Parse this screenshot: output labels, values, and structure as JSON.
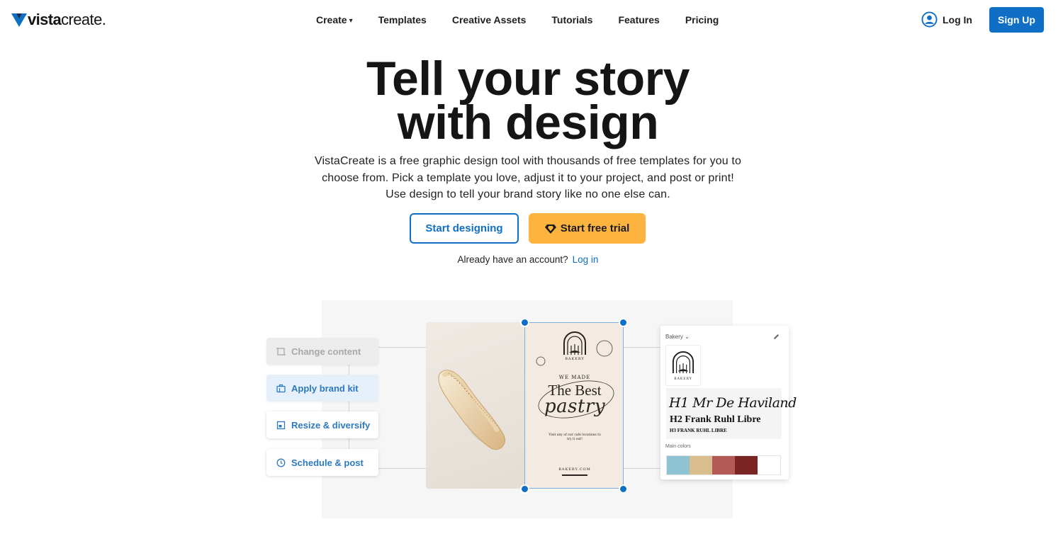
{
  "nav": {
    "logo_bold": "vista",
    "logo_rest": "create",
    "logo_dot": ".",
    "links": [
      {
        "label": "Create"
      },
      {
        "label": "Templates"
      },
      {
        "label": "Creative Assets"
      },
      {
        "label": "Tutorials"
      },
      {
        "label": "Features"
      },
      {
        "label": "Pricing"
      }
    ],
    "create_caret": "▾",
    "login_label": "Log In",
    "signup_label": "Sign Up",
    "accent_color": "#0f6fc6"
  },
  "hero": {
    "title_line1": "Tell your story",
    "title_line2": "with design",
    "description": "VistaCreate is a free graphic design tool with thousands of free templates for you to choose from. Pick a template you love, adjust it to your project, and post or print! Use design to tell your brand story like no one else can.",
    "start_designing_label": "Start designing",
    "start_trial_label": "Start free trial",
    "trial_color": "#fcb43f",
    "account_prompt": "Already have an account?",
    "account_login_label": "Log in"
  },
  "illustration": {
    "features": [
      {
        "label": "Change content",
        "icon": "crop-icon"
      },
      {
        "label": "Apply brand kit",
        "icon": "briefcase-icon"
      },
      {
        "label": "Resize & diversify",
        "icon": "resize-icon"
      },
      {
        "label": "Schedule & post",
        "icon": "clock-icon"
      }
    ],
    "poster": {
      "brand": "BAKERY",
      "we_made": "WE MADE",
      "headline": "The Best",
      "script": "pastry",
      "visit_text": "Visit any of our cafe locations to try it out!",
      "website": "BAKERY.COM"
    },
    "brand_kit": {
      "dropdown_label": "Bakery",
      "dropdown_caret": "⌄",
      "logo_text": "BAKERY",
      "h1_sample": "H1 Mr De Haviland",
      "h2_sample": "H2 Frank Ruhl Libre",
      "h3_sample": "H3 FRANK RUHL LIBRE",
      "colors_label": "Main colors",
      "colors": [
        "#8ec3d4",
        "#d9bd8c",
        "#b35a56",
        "#7a2424",
        "#ffffff"
      ]
    }
  }
}
